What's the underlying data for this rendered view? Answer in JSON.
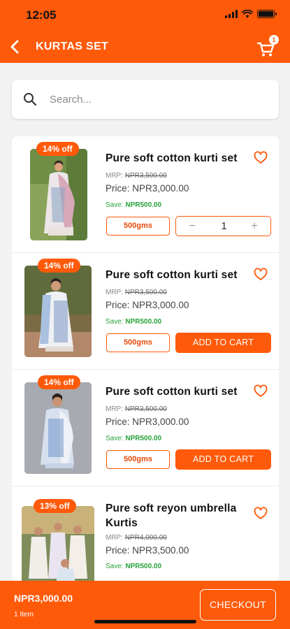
{
  "status_bar": {
    "time": "12:05"
  },
  "header": {
    "title": "KURTAS SET",
    "cart_count": "1"
  },
  "search": {
    "placeholder": "Search..."
  },
  "products": [
    {
      "discount": "14% off",
      "name": "Pure soft cotton kurti set",
      "mrp_label": "MRP:",
      "mrp": "NPR3,500.00",
      "price_label": "Price:",
      "price": "NPR3,000.00",
      "save_label": "Save:",
      "save": "NPR500.00",
      "weight": "500gms",
      "quantity": "1",
      "action": "quantity"
    },
    {
      "discount": "14% off",
      "name": "Pure soft cotton kurti set",
      "mrp_label": "MRP:",
      "mrp": "NPR3,500.00",
      "price_label": "Price:",
      "price": "NPR3,000.00",
      "save_label": "Save:",
      "save": "NPR500.00",
      "weight": "500gms",
      "button": "ADD TO CART"
    },
    {
      "discount": "14% off",
      "name": "Pure soft cotton kurti set",
      "mrp_label": "MRP:",
      "mrp": "NPR3,500.00",
      "price_label": "Price:",
      "price": "NPR3,000.00",
      "save_label": "Save:",
      "save": "NPR500.00",
      "weight": "500gms",
      "button": "ADD TO CART"
    },
    {
      "discount": "13% off",
      "name": "Pure soft reyon umbrella Kurtis",
      "mrp_label": "MRP:",
      "mrp": "NPR4,000.00",
      "price_label": "Price:",
      "price": "NPR3,500.00",
      "save_label": "Save:",
      "save": "NPR500.00"
    }
  ],
  "footer": {
    "total": "NPR3,000.00",
    "items": "1 Item",
    "checkout": "CHECKOUT"
  },
  "colors": {
    "accent": "#ff5a0a",
    "save_green": "#27a33a"
  },
  "icons": [
    "back-arrow-icon",
    "cart-icon",
    "search-icon",
    "heart-icon"
  ]
}
